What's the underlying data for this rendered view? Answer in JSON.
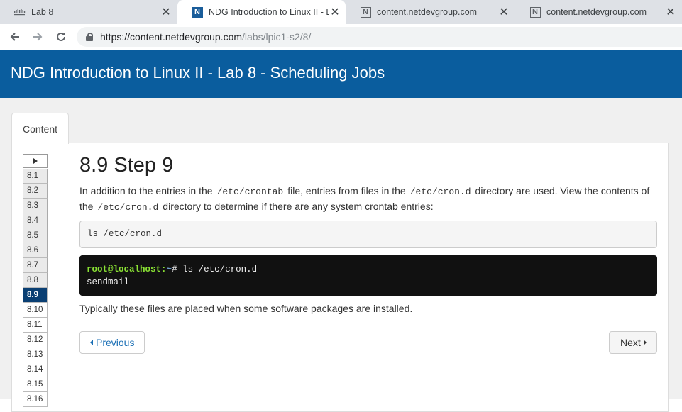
{
  "browser": {
    "tabs": [
      {
        "title": "Lab 8",
        "favicon": "cisco-logo-icon",
        "active": false
      },
      {
        "title": "NDG Introduction to Linux II - Lab",
        "favicon": "ndg-n-icon",
        "active": true
      },
      {
        "title": "content.netdevgroup.com",
        "favicon": "ndg-n-icon",
        "active": false
      },
      {
        "title": "content.netdevgroup.com",
        "favicon": "ndg-n-icon",
        "active": false
      }
    ],
    "close_glyph": "✕",
    "url_host": "https://content.netdevgroup.com",
    "url_path": "/labs/lpic1-s2/8/"
  },
  "page": {
    "header_title": "NDG Introduction to Linux II - Lab 8 - Scheduling Jobs",
    "content_tab": "Content",
    "steps": [
      "8.1",
      "8.2",
      "8.3",
      "8.4",
      "8.5",
      "8.6",
      "8.7",
      "8.8",
      "8.9",
      "8.10",
      "8.11",
      "8.12",
      "8.13",
      "8.14",
      "8.15",
      "8.16"
    ],
    "current_step": "8.9",
    "step_heading": "8.9 Step 9",
    "para": {
      "t1": "In addition to the entries in the",
      "c1": "/etc/crontab",
      "t2": "file, entries from files in the",
      "c2": "/etc/cron.d",
      "t3": "directory are used. View the contents of the",
      "c3": "/etc/cron.d",
      "t4": "directory to determine if there are any system crontab entries:"
    },
    "command": "ls /etc/cron.d",
    "terminal": {
      "user": "root@localhost",
      "sep": ":",
      "path": "~",
      "prompt": "#",
      "cmd": " ls /etc/cron.d",
      "output": "sendmail"
    },
    "after_text": "Typically these files are placed when some software packages are installed.",
    "prev_label": "Previous",
    "next_label": "Next"
  },
  "colors": {
    "header_bg": "#0a5d9e",
    "current_step_bg": "#0a3f73",
    "terminal_user": "#8ae234",
    "terminal_path": "#729fcf"
  }
}
